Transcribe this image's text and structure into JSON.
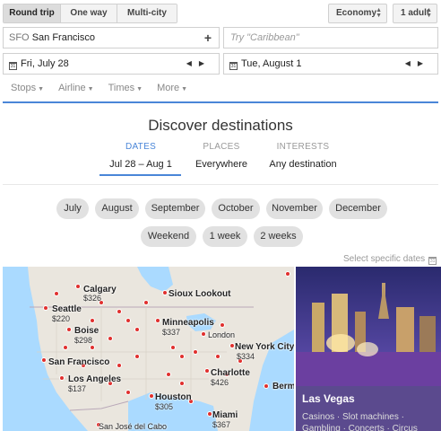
{
  "trip_types": [
    "Round trip",
    "One way",
    "Multi-city"
  ],
  "cabin_class": "Economy",
  "passengers": "1 adult",
  "origin": {
    "code": "SFO",
    "city": "San Francisco"
  },
  "destination_placeholder": "Try \"Caribbean\"",
  "depart_date": "Fri, July 28",
  "return_date": "Tue, August 1",
  "filters": [
    "Stops",
    "Airline",
    "Times",
    "More"
  ],
  "discover": {
    "title": "Discover destinations",
    "tabs": [
      {
        "label": "DATES",
        "value": "Jul 28 – Aug 1"
      },
      {
        "label": "PLACES",
        "value": "Everywhere"
      },
      {
        "label": "INTERESTS",
        "value": "Any destination"
      }
    ]
  },
  "months": [
    "July",
    "August",
    "September",
    "October",
    "November",
    "December"
  ],
  "durations": [
    "Weekend",
    "1 week",
    "2 weeks"
  ],
  "select_dates": "Select specific dates",
  "map_cities": [
    {
      "name": "Calgary",
      "price": "$326"
    },
    {
      "name": "Sioux Lookout",
      "price": ""
    },
    {
      "name": "Seattle",
      "price": "$220"
    },
    {
      "name": "Minneapolis",
      "price": "$337"
    },
    {
      "name": "Boise",
      "price": "$298"
    },
    {
      "name": "London",
      "price": ""
    },
    {
      "name": "New York City",
      "price": "$334"
    },
    {
      "name": "San Francisco",
      "price": ""
    },
    {
      "name": "Los Angeles",
      "price": "$137"
    },
    {
      "name": "Charlotte",
      "price": "$426"
    },
    {
      "name": "Houston",
      "price": "$305"
    },
    {
      "name": "Berm",
      "price": ""
    },
    {
      "name": "Miami",
      "price": "$367"
    },
    {
      "name": "San José del Cabo",
      "price": ""
    }
  ],
  "featured": {
    "name": "Las Vegas",
    "tags_line1": "Casinos · Slot machines ·",
    "tags_line2": "Gambling · Concerts · Circus"
  },
  "colors": {
    "accent": "#4a86d8",
    "pin": "#e0302e",
    "caption_bg": "#5b4a8e"
  }
}
